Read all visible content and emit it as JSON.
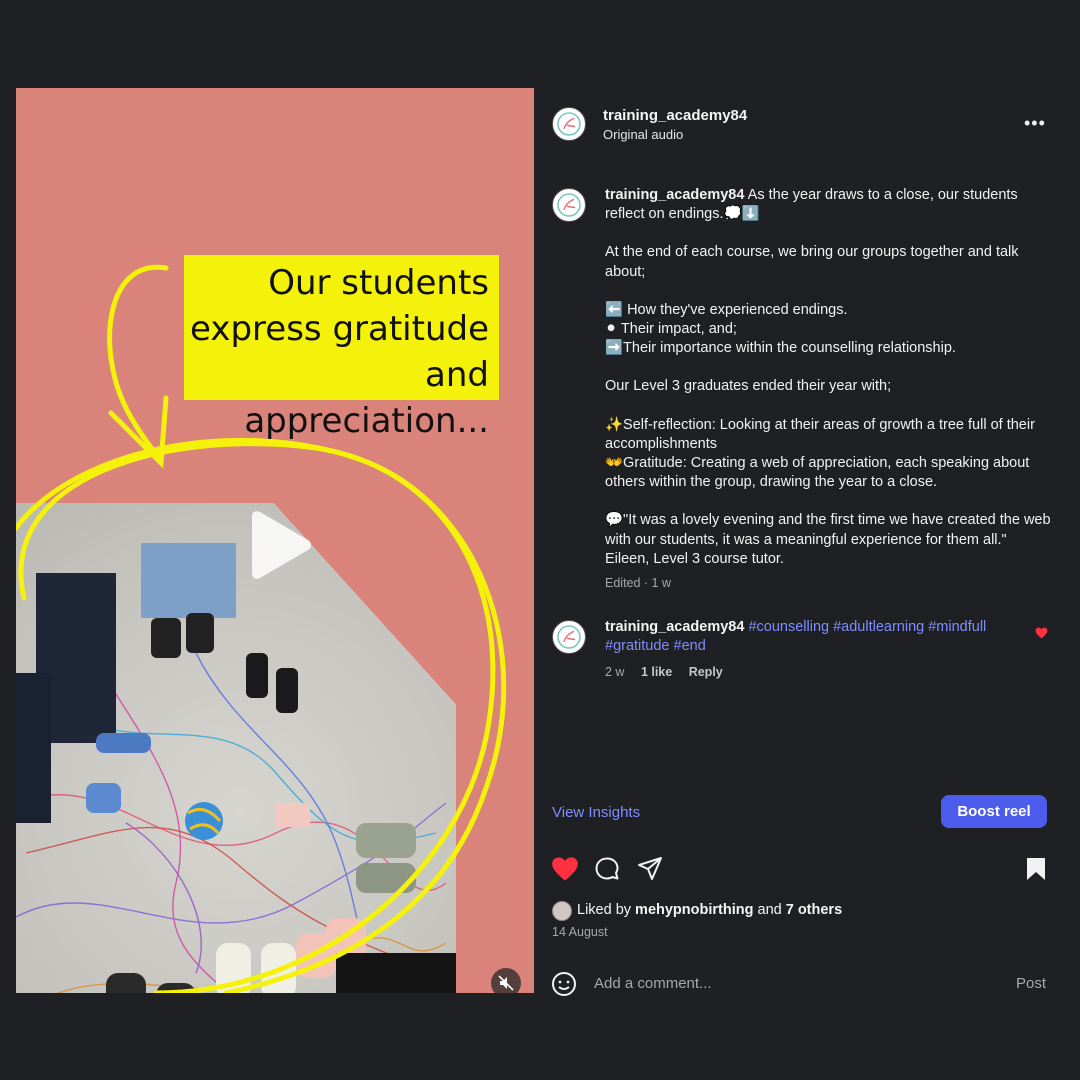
{
  "media": {
    "headline_lines": [
      "Our students",
      "express gratitude",
      "and appreciation..."
    ],
    "play_icon": "play-icon",
    "mute_icon": "muted-speaker-icon"
  },
  "header": {
    "username": "training_academy84",
    "audio": "Original audio",
    "more_icon": "more-options-icon"
  },
  "caption": {
    "username": "training_academy84",
    "intro": "As the year draws to a close, our students reflect on endings.💭⬇️",
    "para2": "At the end of each course, we bring our groups together and talk about;",
    "bullets": [
      "⬅️ How they've experienced endings.",
      "⚫ Their impact, and;",
      "➡️Their importance within the counselling relationship."
    ],
    "para4": "Our Level 3 graduates ended their year with;",
    "reflection": "✨Self-reflection: Looking at their areas of growth a tree full of their accomplishments",
    "gratitude": "👐Gratitude: Creating a web of appreciation, each speaking about others within the group, drawing the year to a close.",
    "quote": "💬\"It was a lovely evening and the first time we have created the web with our students, it was a meaningful experience for them all.\" Eileen, Level 3 course tutor.",
    "edited": "Edited · 1 w"
  },
  "comment": {
    "username": "training_academy84",
    "hashtags": "#counselling #adultlearning #mindfull #gratitude #end",
    "age": "2 w",
    "likes": "1 like",
    "reply": "Reply"
  },
  "footer": {
    "view_insights": "View Insights",
    "boost": "Boost reel",
    "liked_prefix": "Liked by",
    "liked_user": "mehypnobirthing",
    "liked_and": "and",
    "liked_others": "7 others",
    "date": "14 August",
    "comment_placeholder": "Add a comment...",
    "post": "Post"
  },
  "colors": {
    "background": "#1f2023",
    "media_bg": "#d9837a",
    "headline_box": "#f4f20a",
    "link": "#7f8dff",
    "boost": "#4c5ced",
    "heart": "#ff3040"
  }
}
